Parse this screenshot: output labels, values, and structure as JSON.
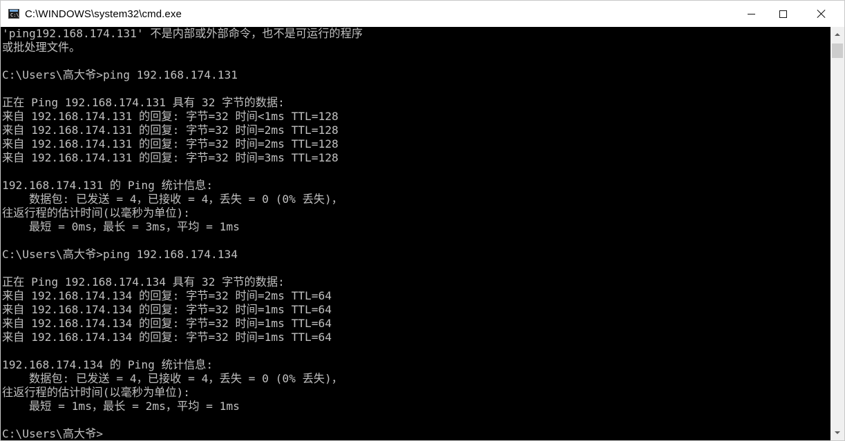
{
  "window": {
    "title": "C:\\WINDOWS\\system32\\cmd.exe",
    "icon": "cmd-icon",
    "icon_text": "C:\\"
  },
  "controls": {
    "minimize": "minimize-icon",
    "maximize": "maximize-icon",
    "close": "close-icon"
  },
  "console": {
    "lines": [
      "'ping192.168.174.131' 不是内部或外部命令，也不是可运行的程序",
      "或批处理文件。",
      "",
      "C:\\Users\\高大爷>ping 192.168.174.131",
      "",
      "正在 Ping 192.168.174.131 具有 32 字节的数据:",
      "来自 192.168.174.131 的回复: 字节=32 时间<1ms TTL=128",
      "来自 192.168.174.131 的回复: 字节=32 时间=2ms TTL=128",
      "来自 192.168.174.131 的回复: 字节=32 时间=2ms TTL=128",
      "来自 192.168.174.131 的回复: 字节=32 时间=3ms TTL=128",
      "",
      "192.168.174.131 的 Ping 统计信息:",
      "    数据包: 已发送 = 4，已接收 = 4，丢失 = 0 (0% 丢失)，",
      "往返行程的估计时间(以毫秒为单位):",
      "    最短 = 0ms，最长 = 3ms，平均 = 1ms",
      "",
      "C:\\Users\\高大爷>ping 192.168.174.134",
      "",
      "正在 Ping 192.168.174.134 具有 32 字节的数据:",
      "来自 192.168.174.134 的回复: 字节=32 时间=2ms TTL=64",
      "来自 192.168.174.134 的回复: 字节=32 时间=1ms TTL=64",
      "来自 192.168.174.134 的回复: 字节=32 时间=1ms TTL=64",
      "来自 192.168.174.134 的回复: 字节=32 时间=1ms TTL=64",
      "",
      "192.168.174.134 的 Ping 统计信息:",
      "    数据包: 已发送 = 4，已接收 = 4，丢失 = 0 (0% 丢失)，",
      "往返行程的估计时间(以毫秒为单位):",
      "    最短 = 1ms，最长 = 2ms，平均 = 1ms",
      "",
      "C:\\Users\\高大爷>"
    ]
  },
  "colors": {
    "console_background": "#000000",
    "console_text": "#c0c0c0",
    "titlebar_background": "#ffffff"
  },
  "scrollbar": {
    "up": "scroll-up-arrow-icon",
    "down": "scroll-down-arrow-icon"
  }
}
